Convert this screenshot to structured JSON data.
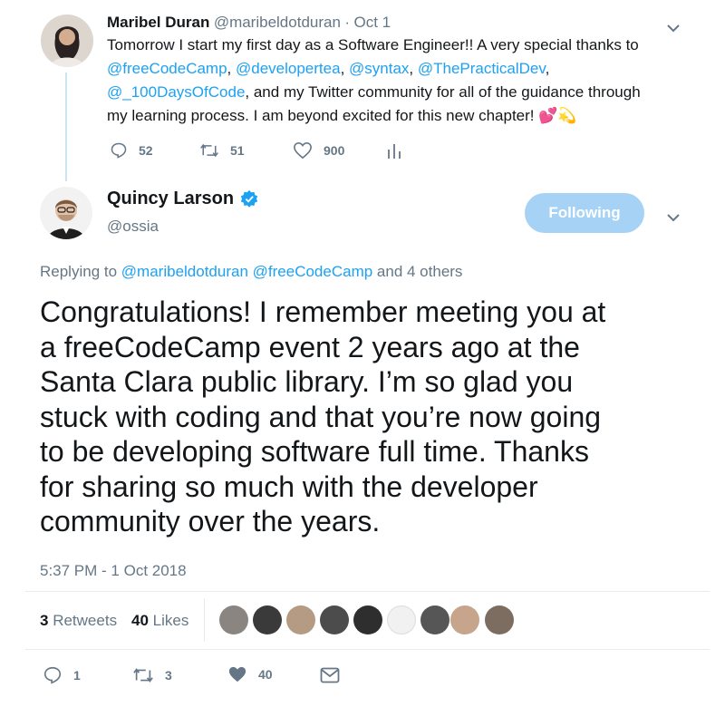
{
  "parent_tweet": {
    "name": "Maribel Duran",
    "handle": "@maribeldotduran",
    "separator": "·",
    "date": "Oct 1",
    "text_line1": "Tomorrow I start my first day as a Software Engineer!! A very special thanks to",
    "mentions_line2": [
      "@freeCodeCamp",
      "@developertea",
      "@syntax",
      "@ThePracticalDev"
    ],
    "mention_line3": "@_100DaysOfCode",
    "text_line3_rest": ", and my Twitter community for all of the guidance through",
    "text_line4": "my learning process. I am beyond excited for this new chapter!",
    "emoji": "💕💫",
    "replies": "52",
    "retweets": "51",
    "likes": "900"
  },
  "main_tweet": {
    "name": "Quincy Larson",
    "handle": "@ossia",
    "follow_label": "Following",
    "replying_prefix": "Replying to",
    "replying_mentions": [
      "@maribeldotduran",
      "@freeCodeCamp"
    ],
    "replying_suffix": "and 4 others",
    "text_lines": [
      "Congratulations! I remember meeting you at",
      "a freeCodeCamp event 2 years ago at the",
      "Santa Clara public library. I’m so glad you",
      "stuck with coding and that you’re now going",
      "to be developing software full time. Thanks",
      "for sharing so much with the developer",
      "community over the years."
    ],
    "timestamp": "5:37 PM - 1 Oct 2018",
    "retweets_count": "3",
    "retweets_label": "Retweets",
    "likes_count": "40",
    "likes_label": "Likes",
    "replies": "1",
    "retweets": "3",
    "likes": "40"
  },
  "icons": {
    "reply": "reply-icon",
    "retweet": "retweet-icon",
    "like": "heart-icon",
    "analytics": "analytics-icon",
    "dm": "envelope-icon",
    "verified": "verified-badge-icon",
    "menu": "chevron-down-icon"
  },
  "colors": {
    "link": "#1da1f2",
    "muted": "#657786",
    "follow_button": "#a5d2f5",
    "thread_line": "#cce3f4"
  }
}
